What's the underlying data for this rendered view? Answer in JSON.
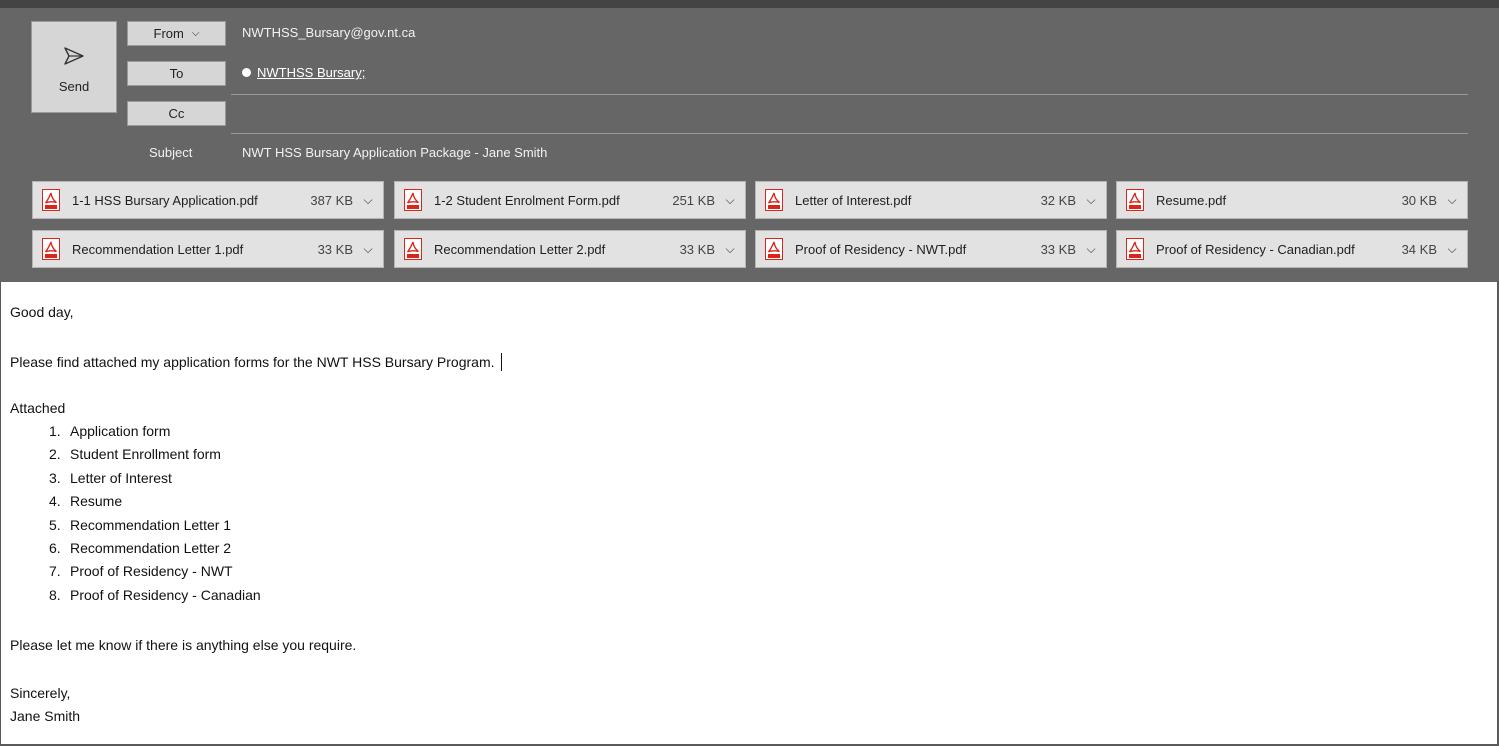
{
  "compose": {
    "send_label": "Send",
    "from_label": "From",
    "from_value": "NWTHSS_Bursary@gov.nt.ca",
    "to_label": "To",
    "to_recipient": "NWTHSS Bursary;",
    "cc_label": "Cc",
    "cc_value": "",
    "subject_label": "Subject",
    "subject_value": "NWT HSS Bursary Application Package - Jane Smith"
  },
  "attachments": [
    {
      "name": "1-1 HSS Bursary Application.pdf",
      "size": "387 KB",
      "icon": "pdf-icon"
    },
    {
      "name": "1-2 Student Enrolment Form.pdf",
      "size": "251 KB",
      "icon": "pdf-icon"
    },
    {
      "name": "Letter of Interest.pdf",
      "size": "32 KB",
      "icon": "pdf-icon"
    },
    {
      "name": "Resume.pdf",
      "size": "30 KB",
      "icon": "pdf-icon"
    },
    {
      "name": "Recommendation Letter 1.pdf",
      "size": "33 KB",
      "icon": "pdf-icon"
    },
    {
      "name": "Recommendation Letter 2.pdf",
      "size": "33 KB",
      "icon": "pdf-icon"
    },
    {
      "name": "Proof of Residency - NWT.pdf",
      "size": "33 KB",
      "icon": "pdf-icon"
    },
    {
      "name": "Proof of Residency - Canadian.pdf",
      "size": "34 KB",
      "icon": "pdf-icon"
    }
  ],
  "message": {
    "greeting": "Good day,",
    "intro": "Please find attached my application forms for the NWT HSS Bursary Program.",
    "attached_heading": "Attached",
    "list": [
      {
        "num": "1.",
        "text": "Application form"
      },
      {
        "num": "2.",
        "text": "Student Enrollment form"
      },
      {
        "num": "3.",
        "text": "Letter of Interest"
      },
      {
        "num": "4.",
        "text": "Resume"
      },
      {
        "num": "5.",
        "text": "Recommendation Letter 1"
      },
      {
        "num": "6.",
        "text": "Recommendation Letter 2"
      },
      {
        "num": "7.",
        "text": "Proof of Residency - NWT"
      },
      {
        "num": "8.",
        "text": "Proof of Residency - Canadian"
      }
    ],
    "closing_line": "Please let me know if there is anything else you require.",
    "signoff": "Sincerely,",
    "signature": "Jane Smith"
  },
  "colors": {
    "header_bg": "#666666",
    "button_bg": "#d6d6d6",
    "attachment_bg": "#e2e2e2",
    "pdf_red": "#d9261c"
  }
}
